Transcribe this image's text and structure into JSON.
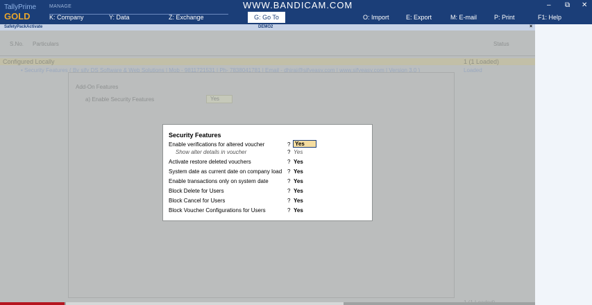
{
  "app": {
    "name_line1": "TallyPrime",
    "name_line2": "GOLD",
    "section": "MANAGE"
  },
  "watermark": "WWW.BANDICAM.COM",
  "menu": {
    "company": "K: Company",
    "data": "Y: Data",
    "exchange": "Z: Exchange",
    "goto": "G: Go To",
    "import": "O: Import",
    "export": "E: Export",
    "email": "M: E-mail",
    "print": "P: Print",
    "help": "F1: Help"
  },
  "window_controls": {
    "minimize": "–",
    "restore": "⧉",
    "close": "✕"
  },
  "header_strip": {
    "left": "SafetyPackActivate",
    "center": "DEMO2",
    "close": "×"
  },
  "table": {
    "col_sno": "S.No.",
    "col_particulars": "Particulars",
    "col_status": "Status",
    "group_title": "Configured Locally",
    "group_status": "1 (1 Loaded)",
    "item_text": "•  Security Features ( By sify DS Software & Web Solutions | Mob - 9811721531 | Ph- 7838041781 | Email - dhiraj@sifyeasy.com | www.sifyeasy.com | Version 3.0 )",
    "item_status": "Loaded",
    "bottom_status": "1 (1 Loaded)"
  },
  "addon": {
    "title": "Add-On Features",
    "label": "a) Enable Security Features",
    "value": "Yes"
  },
  "dialog": {
    "title": "Security Features",
    "rows": [
      {
        "label": "Enable verifications for altered voucher",
        "q": "?",
        "value": "Yes"
      },
      {
        "label": "Show alter details in voucher",
        "q": "?",
        "value": "Yes"
      },
      {
        "label": "Activate restore deleted vouchers",
        "q": "?",
        "value": "Yes"
      },
      {
        "label": "System date as current date on company load",
        "q": "?",
        "value": "Yes"
      },
      {
        "label": "Enable transactions only on system date",
        "q": "?",
        "value": "Yes"
      },
      {
        "label": "Block Delete for Users",
        "q": "?",
        "value": "Yes"
      },
      {
        "label": "Block Cancel for Users",
        "q": "?",
        "value": "Yes"
      },
      {
        "label": "Block Voucher Configurations for Users",
        "q": "?",
        "value": "Yes"
      }
    ]
  },
  "colors": {
    "topbar": "#1b3e78",
    "brand_gold": "#e7a52d",
    "active_field": "#f5dda0",
    "progress": "#b51620"
  },
  "progress": {
    "fraction": 0.12
  }
}
